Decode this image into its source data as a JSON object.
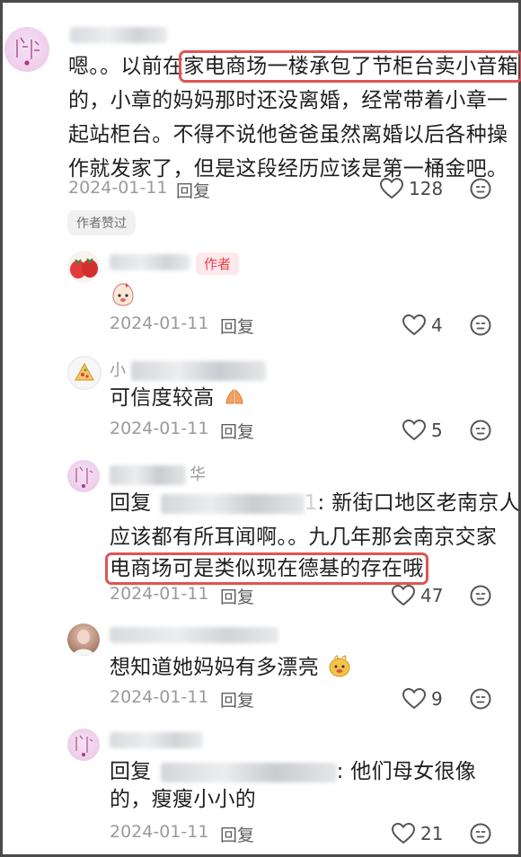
{
  "colors": {
    "highlight": "#e05454",
    "author_badge_text": "#e8424d",
    "author_badge_bg": "#fde9ea"
  },
  "comments": [
    {
      "lines": [
        "嗯。。以前在家电商场一楼承包了节柜台卖小音箱",
        "的，小章的妈妈那时还没离婚，经常带着小章一",
        "起站柜台。不得不说他爸爸虽然离婚以后各种操",
        "作就发家了，但是这段经历应该是第一桶金吧。"
      ],
      "line1_prefix": "嗯。。以前在",
      "line1_highlight": "家电商场一楼承包了节柜台卖小音箱",
      "date": "2024-01-11",
      "reply_label": "回复",
      "likes": "128",
      "liked_by_author": "作者赞过"
    },
    {
      "author_badge": "作者",
      "date": "2024-01-11",
      "reply_label": "回复",
      "likes": "4"
    },
    {
      "name_visible": "小",
      "text": "可信度较高",
      "date": "2024-01-11",
      "reply_label": "回复",
      "likes": "5"
    },
    {
      "name_visible": "华",
      "reply_prefix": "回复",
      "reply_to_tail": "1",
      "line1_text": ": 新街口地区老南京人",
      "line2": "应该都有所耳闻啊。。九几年那会南京交家",
      "line3_highlight": "电商场可是类似现在德基的存在哦",
      "date": "2024-01-11",
      "reply_label": "回复",
      "likes": "47"
    },
    {
      "text": "想知道她妈妈有多漂亮",
      "date": "2024-01-11",
      "reply_label": "回复",
      "likes": "9"
    },
    {
      "reply_prefix": "回复",
      "line1_text": ": 他们母女很像",
      "line2": "的，瘦瘦小小的",
      "date": "2024-01-11",
      "reply_label": "回复",
      "likes": "21"
    }
  ]
}
